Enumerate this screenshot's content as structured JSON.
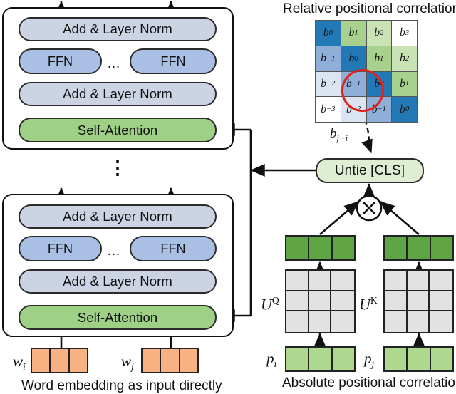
{
  "figure": {
    "title_right_top": "Relative positional correlation",
    "caption_right_bottom": "Absolute positional correlation",
    "caption_left_bottom": "Word embedding as input directly"
  },
  "encoder": {
    "blocks": [
      {
        "id": "upper-transformer-block",
        "layers": {
          "add_norm_top": "Add & Layer Norm",
          "ffn_left": "FFN",
          "ffn_ellipsis": "…",
          "ffn_right": "FFN",
          "add_norm_bottom": "Add & Layer Norm",
          "self_attention": "Self-Attention"
        }
      },
      {
        "id": "lower-transformer-block",
        "layers": {
          "add_norm_top": "Add & Layer Norm",
          "ffn_left": "FFN",
          "ffn_ellipsis": "…",
          "ffn_right": "FFN",
          "add_norm_bottom": "Add & Layer Norm",
          "self_attention": "Self-Attention"
        }
      }
    ],
    "stack_ellipsis": "⋮"
  },
  "word_embeddings": {
    "left_label": "w",
    "left_sub": "i",
    "right_label": "w",
    "right_sub": "j",
    "cells_per_token": 3,
    "color": "#f7b183"
  },
  "relative_matrix": {
    "size": 4,
    "cells": [
      [
        {
          "base": "b",
          "sub": "0",
          "color": "#2279b5"
        },
        {
          "base": "b",
          "sub": "1",
          "color": "#a9d18e"
        },
        {
          "base": "b",
          "sub": "2",
          "color": "#c9e3b4"
        },
        {
          "base": "b",
          "sub": "3",
          "color": "#ffffff"
        }
      ],
      [
        {
          "base": "b",
          "sub": "−1",
          "color": "#8faed8"
        },
        {
          "base": "b",
          "sub": "0",
          "color": "#2279b5"
        },
        {
          "base": "b",
          "sub": "1",
          "color": "#a9d18e"
        },
        {
          "base": "b",
          "sub": "2",
          "color": "#c9e3b4"
        }
      ],
      [
        {
          "base": "b",
          "sub": "−2",
          "color": "#dbe5f1"
        },
        {
          "base": "b",
          "sub": "−1",
          "color": "#8faed8"
        },
        {
          "base": "b",
          "sub": "0",
          "color": "#2279b5"
        },
        {
          "base": "b",
          "sub": "1",
          "color": "#a9d18e"
        }
      ],
      [
        {
          "base": "b",
          "sub": "−3",
          "color": "#ffffff"
        },
        {
          "base": "b",
          "sub": "−2",
          "color": "#dbe5f1"
        },
        {
          "base": "b",
          "sub": "−1",
          "color": "#8faed8"
        },
        {
          "base": "b",
          "sub": "0",
          "color": "#2279b5"
        }
      ]
    ],
    "highlight": {
      "row": 2,
      "col": 1,
      "color": "#e0201b"
    },
    "bias_label_base": "b",
    "bias_label_sub": "j−i"
  },
  "untie": {
    "label": "Untie [CLS]",
    "color": "#dfeed2"
  },
  "multiply_node": {
    "glyph": "×"
  },
  "projection": {
    "left": {
      "matrix_label_base": "U",
      "matrix_label_sup": "Q",
      "input_label_base": "p",
      "input_label_sub": "i"
    },
    "right": {
      "matrix_label_base": "U",
      "matrix_label_sup": "K",
      "input_label_base": "p",
      "input_label_sub": "j"
    },
    "matrix_cell_color": "#e2e2e2",
    "output_vector_color": "#5fa544",
    "input_vector_color": "#aed88f",
    "cells": 3
  }
}
